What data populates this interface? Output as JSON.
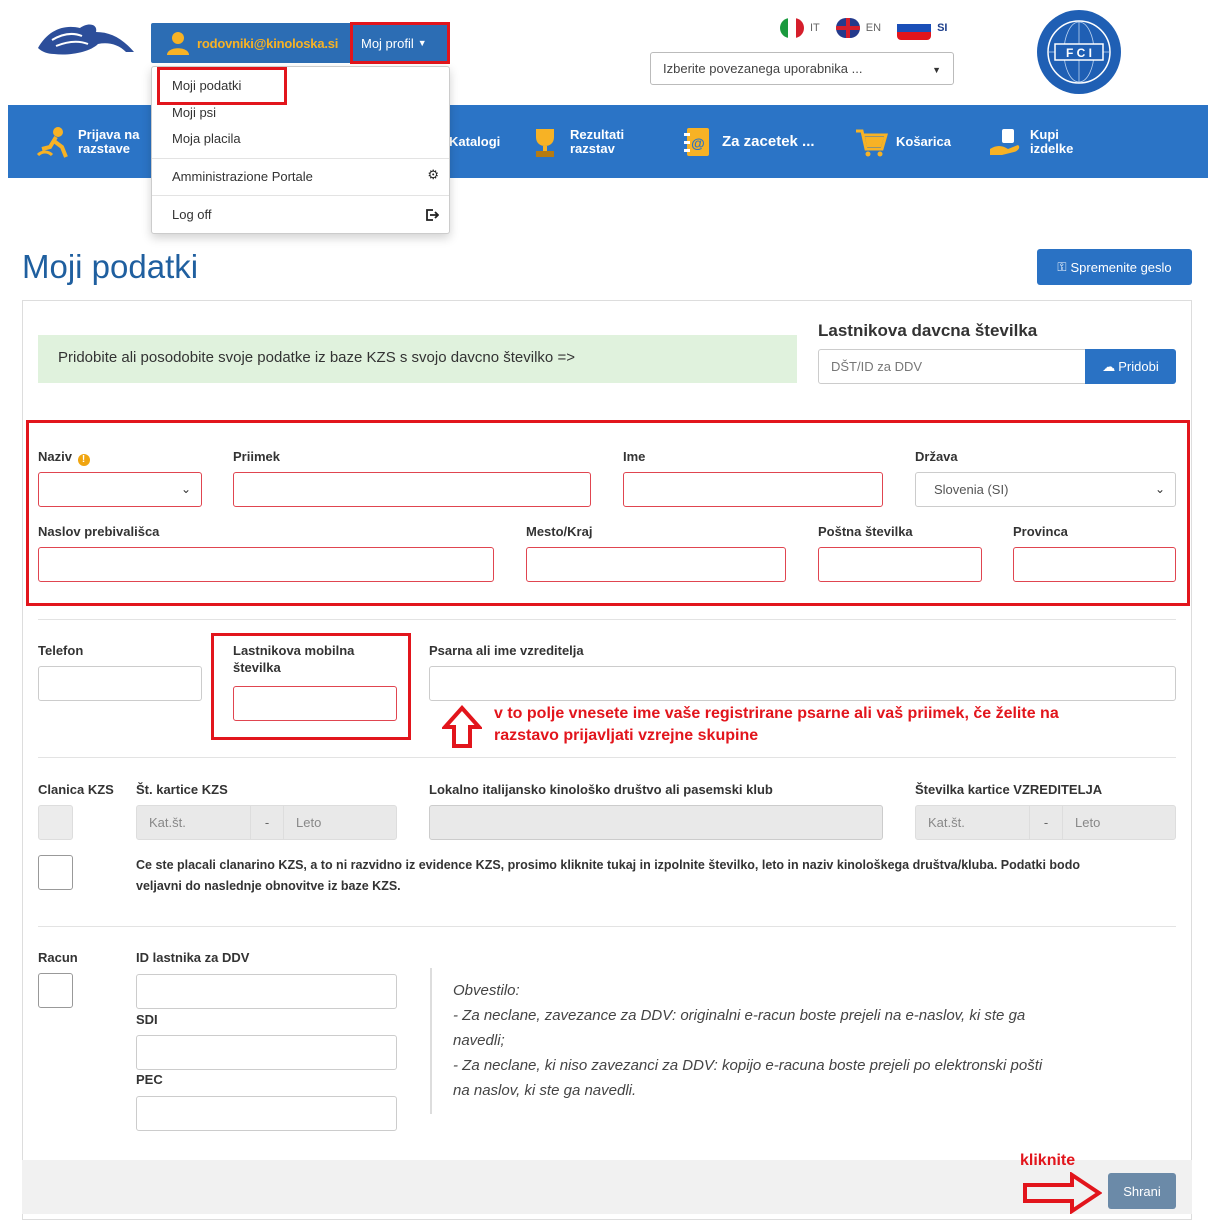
{
  "header": {
    "user_email": "rodovniki@kinoloska.si",
    "profile_label": "Moj profil",
    "languages": [
      {
        "code": "IT",
        "flag": "flag-it"
      },
      {
        "code": "EN",
        "flag": "flag-uk"
      },
      {
        "code": "SI",
        "flag": "flag-si"
      }
    ],
    "linked_user_placeholder": "Izberite povezanega uporabnika ..."
  },
  "profile_menu": {
    "items": [
      "Moji podatki",
      "Moji psi",
      "Moja placila"
    ],
    "admin_label": "Amministrazione Portale",
    "logoff_label": "Log off"
  },
  "nav": {
    "items": [
      {
        "line1": "Prijava na",
        "line2": "razstave"
      },
      {
        "line1": "Katalogi",
        "line2": ""
      },
      {
        "line1": "Rezultati",
        "line2": "razstav"
      },
      {
        "line1": "Za zacetek ...",
        "line2": ""
      },
      {
        "line1": "Košarica",
        "line2": ""
      },
      {
        "line1": "Kupi",
        "line2": "izdelke"
      }
    ]
  },
  "page": {
    "title": "Moji podatki",
    "change_password_label": "Spremenite geslo"
  },
  "kzs": {
    "info_text": "Pridobite ali posodobite svoje podatke iz baze KZS s svojo davcno številko =>",
    "tax_title": "Lastnikova davcna številka",
    "tax_placeholder": "DŠT/ID za DDV",
    "fetch_label": "Pridobi"
  },
  "form": {
    "title_label": "Naziv",
    "surname_label": "Priimek",
    "name_label": "Ime",
    "country_label": "Država",
    "country_value": "Slovenia (SI)",
    "address_label": "Naslov prebivališca",
    "city_label": "Mesto/Kraj",
    "postcode_label": "Poštna številka",
    "province_label": "Provinca",
    "phone_label": "Telefon",
    "mobile_label_1": "Lastnikova mobilna",
    "mobile_label_2": "številka",
    "kennel_label": "Psarna ali ime vzreditelja",
    "member_label": "Clanica KZS",
    "card_label": "Št. kartice KZS",
    "card_num_placeholder": "Kat.št.",
    "card_year_placeholder": "Leto",
    "dash": "-",
    "club_label": "Lokalno italijansko kinološko društvo ali pasemski klub",
    "breeder_card_label": "Številka kartice VZREDITELJA",
    "paid_text_1": "Ce ste placali clanarino KZS, a to ni razvidno iz evidence KZS, prosimo kliknite tukaj in izpolnite številko, leto in naziv kinološkega društva/kluba. Podatki bodo",
    "paid_text_2": "veljavni do naslednje obnovitve iz baze KZS.",
    "invoice_label": "Racun",
    "vat_id_label": "ID lastnika za DDV",
    "sdi_label": "SDI",
    "pec_label": "PEC",
    "notice": [
      "Obvestilo:",
      "- Za neclane, zavezance za DDV: originalni e-racun boste prejeli na e-naslov, ki ste ga",
      "navedli;",
      "- Za neclane, ki niso zavezanci za DDV: kopijo e-racuna boste prejeli po elektronski pošti",
      "na naslov, ki ste ga navedli."
    ],
    "save_label": "Shrani"
  },
  "annotations": {
    "kennel_hint_1": "v to polje vnesete ime vaše registrirane psarne ali vaš priimek, če želite na",
    "kennel_hint_2": "razstavo prijavljati vzrejne skupine",
    "click_hint": "kliknite"
  },
  "colors": {
    "brand_blue": "#2b74c6",
    "highlight_red": "#e2151c",
    "info_green": "#e0f2dd"
  }
}
